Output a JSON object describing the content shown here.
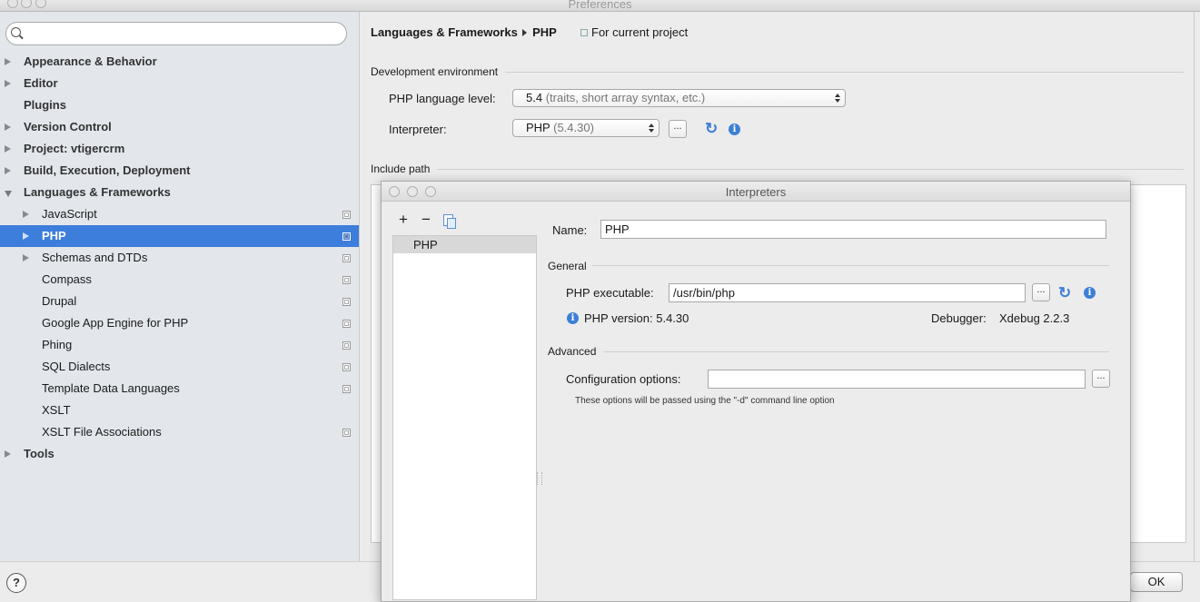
{
  "window": {
    "title": "Preferences"
  },
  "sidebar": {
    "search": {
      "placeholder": ""
    },
    "items": [
      {
        "label": "Appearance & Behavior",
        "arrow": "right",
        "bold": true
      },
      {
        "label": "Editor",
        "arrow": "right",
        "bold": true
      },
      {
        "label": "Plugins",
        "arrow": "none",
        "bold": true
      },
      {
        "label": "Version Control",
        "arrow": "right",
        "bold": true
      },
      {
        "label": "Project: vtigercrm",
        "arrow": "right",
        "bold": true
      },
      {
        "label": "Build, Execution, Deployment",
        "arrow": "right",
        "bold": true
      },
      {
        "label": "Languages & Frameworks",
        "arrow": "down",
        "bold": true
      },
      {
        "label": "JavaScript",
        "arrow": "right",
        "child": true,
        "project": true
      },
      {
        "label": "PHP",
        "arrow": "right",
        "child": true,
        "project": true,
        "selected": true
      },
      {
        "label": "Schemas and DTDs",
        "arrow": "right",
        "child": true,
        "project": true
      },
      {
        "label": "Compass",
        "child": true,
        "project": true
      },
      {
        "label": "Drupal",
        "child": true,
        "project": true
      },
      {
        "label": "Google App Engine for PHP",
        "child": true,
        "project": true
      },
      {
        "label": "Phing",
        "child": true,
        "project": true
      },
      {
        "label": "SQL Dialects",
        "child": true,
        "project": true
      },
      {
        "label": "Template Data Languages",
        "child": true,
        "project": true
      },
      {
        "label": "XSLT",
        "child": true,
        "project": false
      },
      {
        "label": "XSLT File Associations",
        "child": true,
        "project": true
      },
      {
        "label": "Tools",
        "arrow": "right",
        "bold": true
      }
    ]
  },
  "main": {
    "breadcrumb": {
      "parent": "Languages & Frameworks",
      "current": "PHP",
      "scope": "For current project"
    },
    "dev_env": {
      "section": "Development environment",
      "language_level_label": "PHP language level:",
      "language_level_value": "5.4",
      "language_level_hint": "(traits, short array syntax, etc.)",
      "interpreter_label": "Interpreter:",
      "interpreter_value": "PHP",
      "interpreter_version": "(5.4.30)",
      "dots": "..."
    },
    "include_path": {
      "section": "Include path"
    }
  },
  "dialog": {
    "title": "Interpreters",
    "toolbar": {
      "add": "+",
      "remove": "−"
    },
    "list": [
      "PHP"
    ],
    "name_label": "Name:",
    "name_value": "PHP",
    "general": {
      "section": "General",
      "exe_label": "PHP executable:",
      "exe_value": "/usr/bin/php",
      "version_text": "PHP version: 5.4.30",
      "debugger_label": "Debugger:",
      "debugger_value": "Xdebug 2.2.3"
    },
    "advanced": {
      "section": "Advanced",
      "config_label": "Configuration options:",
      "config_value": "",
      "note": "These options will be passed using the \"-d\" command line option"
    },
    "dots": "..."
  },
  "footer": {
    "help": "?",
    "ok": "OK"
  },
  "colors": {
    "selection": "#3d7ddb",
    "accent": "#3d7fd6"
  }
}
